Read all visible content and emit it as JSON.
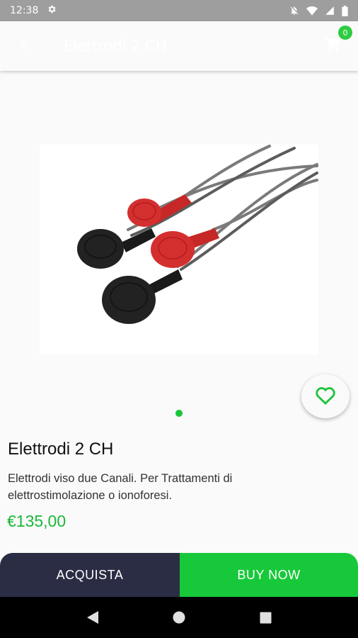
{
  "status_bar": {
    "time": "12:38",
    "icons": [
      "gear-icon",
      "notifications-off-icon",
      "wifi-icon",
      "signal-icon",
      "battery-icon"
    ]
  },
  "app_bar": {
    "title": "Elettrodi 2 CH",
    "cart_count": "0",
    "icons": [
      "back-arrow-icon",
      "cart-icon"
    ]
  },
  "product": {
    "name": "Elettrodi 2 CH",
    "description": "Elettrodi viso due Canali. Per Trattamenti di elettrostimolazione o ionoforesi.",
    "price": "€135,00",
    "image_alt": "electrodes-image"
  },
  "actions": {
    "acquista_label": "ACQUISTA",
    "buy_now_label": "BUY NOW"
  },
  "colors": {
    "accent_green": "#1bc43a",
    "dark_button": "#2a2d44",
    "status_bar": "#9e9e9e"
  }
}
